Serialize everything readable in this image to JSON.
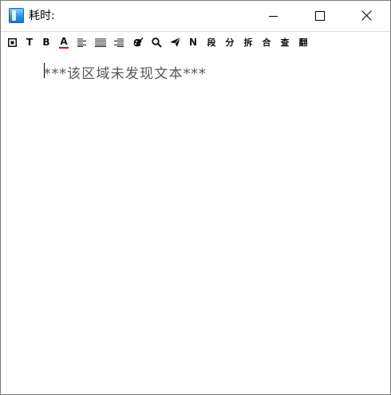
{
  "window": {
    "title": "耗时:",
    "icon": "app-notebook-icon"
  },
  "toolbar": {
    "items": [
      {
        "name": "frame-icon",
        "label": ""
      },
      {
        "name": "text-t",
        "label": "T"
      },
      {
        "name": "bold",
        "label": "B"
      },
      {
        "name": "font-color",
        "label": "A",
        "underline_color": "#e00000"
      },
      {
        "name": "align-left-icon",
        "label": ""
      },
      {
        "name": "align-justify-icon",
        "label": ""
      },
      {
        "name": "align-right-icon",
        "label": ""
      },
      {
        "name": "paint-icon",
        "label": ""
      },
      {
        "name": "search-icon",
        "label": ""
      },
      {
        "name": "send-icon",
        "label": ""
      },
      {
        "name": "n",
        "label": "N"
      },
      {
        "name": "segment",
        "label": "段"
      },
      {
        "name": "split",
        "label": "分"
      },
      {
        "name": "disassemble",
        "label": "拆"
      },
      {
        "name": "merge",
        "label": "合"
      },
      {
        "name": "lookup",
        "label": "查"
      },
      {
        "name": "translate",
        "label": "翻"
      }
    ]
  },
  "editor": {
    "content": "***该区域未发现文本***"
  },
  "colors": {
    "text": "#555555",
    "border": "#7a7a7a",
    "accent_red": "#e00000"
  }
}
